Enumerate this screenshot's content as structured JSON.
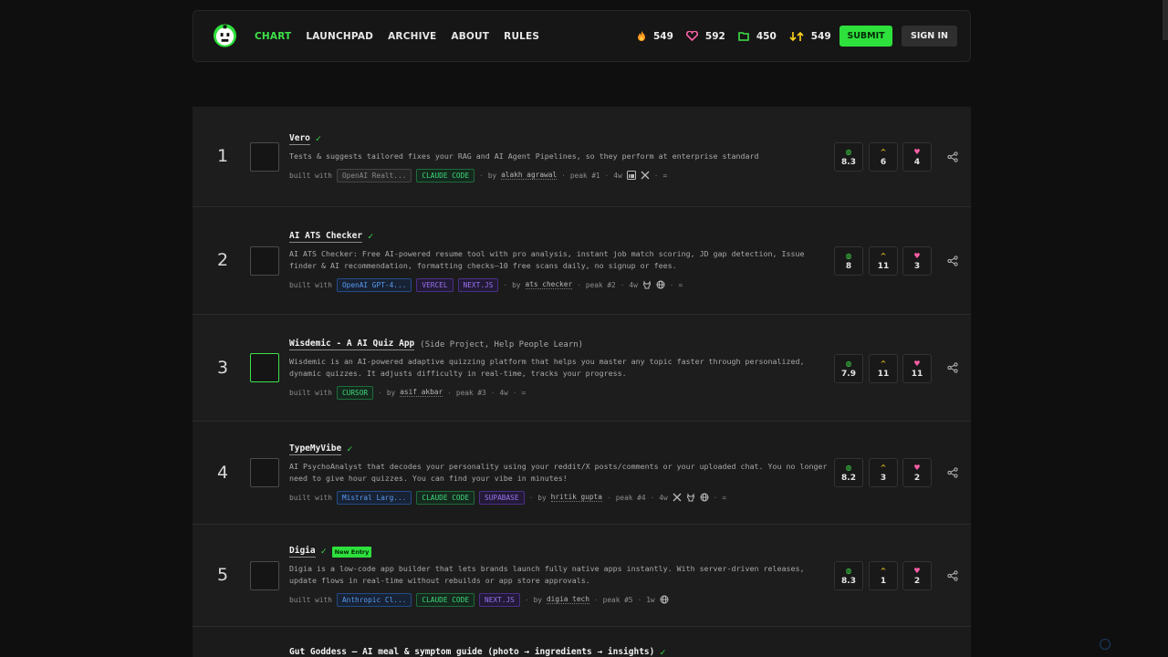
{
  "nav": {
    "links": [
      "CHART",
      "LAUNCHPAD",
      "ARCHIVE",
      "ABOUT",
      "RULES"
    ],
    "stats": [
      {
        "icon": "fire-icon",
        "value": "549"
      },
      {
        "icon": "heart-icon",
        "value": "592"
      },
      {
        "icon": "folder-icon",
        "value": "450"
      },
      {
        "icon": "arrows-icon",
        "value": "549"
      }
    ],
    "submit": "SUBMIT",
    "signin": "SIGN IN"
  },
  "rows": [
    {
      "rank": "1",
      "title": "Vero",
      "sub": "",
      "badge": "",
      "desc": "Tests & suggests tailored fixes your RAG and AI Agent Pipelines, so they perform at enterprise standard",
      "built_with": "built with",
      "tags": [
        {
          "label": "OpenAI Realt...",
          "kind": "gray"
        },
        {
          "label": "CLAUDE CODE",
          "kind": "green"
        }
      ],
      "by": "by",
      "author": "alakh agrawal",
      "peak": "peak #1",
      "age": "4w",
      "score": "8.3",
      "up": "6",
      "likes": "4"
    },
    {
      "rank": "2",
      "title": "AI ATS Checker",
      "sub": "",
      "badge": "",
      "desc": "AI ATS Checker: Free AI-powered resume tool with pro analysis, instant job match scoring, JD gap detection, Issue finder & AI recommendation, formatting checks—10 free scans daily, no signup or fees.",
      "built_with": "built with",
      "tags": [
        {
          "label": "OpenAI GPT-4...",
          "kind": "blue"
        },
        {
          "label": "VERCEL",
          "kind": "purple"
        },
        {
          "label": "NEXT.JS",
          "kind": "purple"
        }
      ],
      "by": "by",
      "author": "ats checker",
      "peak": "peak #2",
      "age": "4w",
      "score": "8",
      "up": "11",
      "likes": "3"
    },
    {
      "rank": "3",
      "title": "Wisdemic - A AI Quiz App",
      "sub": "(Side Project, Help People Learn)",
      "badge": "",
      "desc": "Wisdemic is an AI-powered adaptive quizzing platform that helps you master any topic faster through personalized, dynamic quizzes. It adjusts difficulty in real-time, tracks your progress.",
      "built_with": "built with",
      "tags": [
        {
          "label": "CURSOR",
          "kind": "green"
        }
      ],
      "by": "by",
      "author": "asif akbar",
      "peak": "peak #3",
      "age": "4w",
      "score": "7.9",
      "up": "11",
      "likes": "11"
    },
    {
      "rank": "4",
      "title": "TypeMyVibe",
      "sub": "",
      "badge": "",
      "desc": "AI PsychoAnalyst that decodes your personality using your reddit/X posts/comments or your uploaded chat. You no longer need to give hour quizzes. You can find your vibe in minutes!",
      "built_with": "built with",
      "tags": [
        {
          "label": "Mistral Larg...",
          "kind": "blue"
        },
        {
          "label": "CLAUDE CODE",
          "kind": "green"
        },
        {
          "label": "SUPABASE",
          "kind": "purple"
        }
      ],
      "by": "by",
      "author": "hritik gupta",
      "peak": "peak #4",
      "age": "4w",
      "score": "8.2",
      "up": "3",
      "likes": "2"
    },
    {
      "rank": "5",
      "title": "Digia",
      "sub": "",
      "badge": "New Entry",
      "desc": "Digia is a low-code app builder that lets brands launch fully native apps instantly. With server-driven releases, update flows in real-time without rebuilds or app store approvals.",
      "built_with": "built with",
      "tags": [
        {
          "label": "Anthropic Cl...",
          "kind": "blue"
        },
        {
          "label": "CLAUDE CODE",
          "kind": "green"
        },
        {
          "label": "NEXT.JS",
          "kind": "purple"
        }
      ],
      "by": "by",
      "author": "digia tech",
      "peak": "peak #5",
      "age": "1w",
      "score": "8.3",
      "up": "1",
      "likes": "2"
    },
    {
      "rank": "",
      "title": "Gut Goddess — AI meal & symptom guide (photo → ingredients → insights)",
      "sub": "",
      "badge": "",
      "desc": "",
      "built_with": "",
      "tags": [],
      "by": "",
      "author": "",
      "peak": "",
      "age": "",
      "score": "",
      "up": "",
      "likes": ""
    }
  ],
  "colors": {
    "accent": "#2ee03c",
    "background": "#0f0f0f",
    "row": "#1d1d1d"
  }
}
